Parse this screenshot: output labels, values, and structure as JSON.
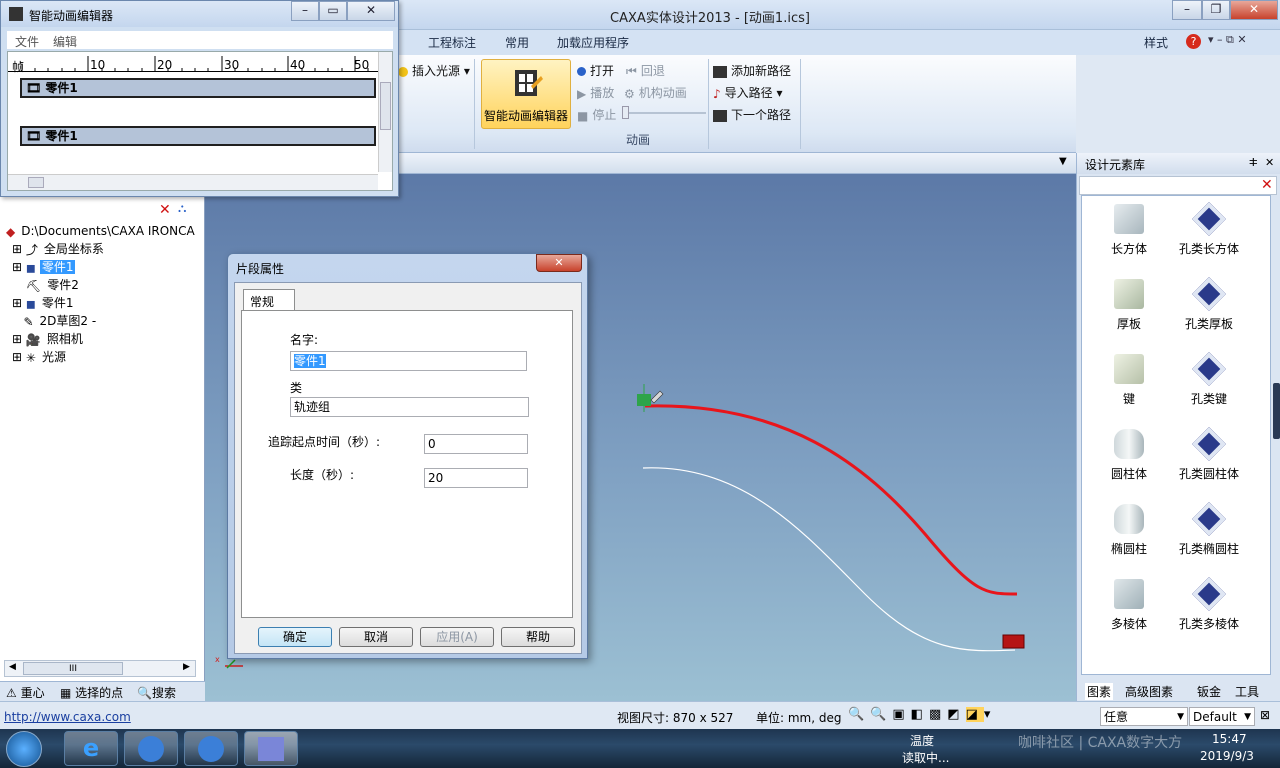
{
  "app": {
    "title": "CAXA实体设计2013 - [动画1.ics]",
    "style_menu": "样式",
    "help_icon": "?"
  },
  "ribbon": {
    "tabs": [
      "工程标注",
      "常用",
      "加载应用程序"
    ],
    "insert_light": "插入光源",
    "big_button": "智能动画编辑器",
    "play_group": {
      "open": "打开",
      "back": "回退",
      "play": "播放",
      "mechanism": "机构动画",
      "stop": "停止"
    },
    "path_group": {
      "add_path": "添加新路径",
      "import_path": "导入路径",
      "next_path": "下一个路径"
    },
    "group_label": "动画"
  },
  "anim_editor": {
    "title": "智能动画编辑器",
    "menu": [
      "文件",
      "编辑"
    ],
    "ruler_label": "帧",
    "ruler_ticks": [
      "10",
      "20",
      "30",
      "40",
      "50"
    ],
    "tracks": [
      "零件1",
      "零件1"
    ]
  },
  "tree": {
    "root": "D:\\Documents\\CAXA IRONCA",
    "items": [
      {
        "label": "全局坐标系",
        "icon": "axes-icon"
      },
      {
        "label": "零件1",
        "icon": "part-icon",
        "selected": true
      },
      {
        "label": "零件2",
        "icon": "part2-icon"
      },
      {
        "label": "零件1",
        "icon": "part-icon"
      },
      {
        "label": "2D草图2 -",
        "icon": "sketch-icon"
      },
      {
        "label": "照相机",
        "icon": "camera-icon"
      },
      {
        "label": "光源",
        "icon": "light-icon"
      }
    ],
    "scroll_label": "III",
    "tabs": [
      "重心",
      "选择的点",
      "搜索"
    ]
  },
  "dialog": {
    "title": "片段属性",
    "tab": "常规",
    "name_label": "名字:",
    "name_value": "零件1",
    "class_label": "类",
    "class_value": "轨迹组",
    "start_label": "追踪起点时间（秒）:",
    "start_value": "0",
    "length_label": "长度（秒）:",
    "length_value": "20",
    "buttons": [
      "确定",
      "取消",
      "应用(A)",
      "帮助"
    ]
  },
  "design_library": {
    "title": "设计元素库",
    "items": [
      {
        "label": "长方体",
        "icon": "cuboid-icon"
      },
      {
        "label": "孔类长方体",
        "icon": "hole-cuboid-icon"
      },
      {
        "label": "厚板",
        "icon": "plate-icon"
      },
      {
        "label": "孔类厚板",
        "icon": "hole-plate-icon"
      },
      {
        "label": "键",
        "icon": "key-icon"
      },
      {
        "label": "孔类键",
        "icon": "hole-key-icon"
      },
      {
        "label": "圆柱体",
        "icon": "cylinder-icon"
      },
      {
        "label": "孔类圆柱体",
        "icon": "hole-cylinder-icon"
      },
      {
        "label": "椭圆柱",
        "icon": "elliptic-cylinder-icon"
      },
      {
        "label": "孔类椭圆柱",
        "icon": "hole-elliptic-cylinder-icon"
      },
      {
        "label": "多棱体",
        "icon": "prism-icon"
      },
      {
        "label": "孔类多棱体",
        "icon": "hole-prism-icon"
      }
    ],
    "tabs": [
      "图素",
      "高级图素",
      "钣金",
      "工具"
    ]
  },
  "status": {
    "url": "http://www.caxa.com",
    "view_size": "视图尺寸: 870 x 527",
    "units": "单位: mm, deg",
    "select_mode": "任意",
    "style_default": "Default"
  },
  "taskbar": {
    "temp_label": "温度",
    "reading": "读取中...",
    "watermark": "咖啡社区 | CAXA数字大方",
    "time": "15:47",
    "date": "2019/9/3"
  },
  "colors": {
    "accent": "#ffd35c",
    "selection": "#3399ff",
    "path_red": "#e8151b",
    "viewport_top": "#5c79a7",
    "viewport_bottom": "#9cc0d3"
  }
}
